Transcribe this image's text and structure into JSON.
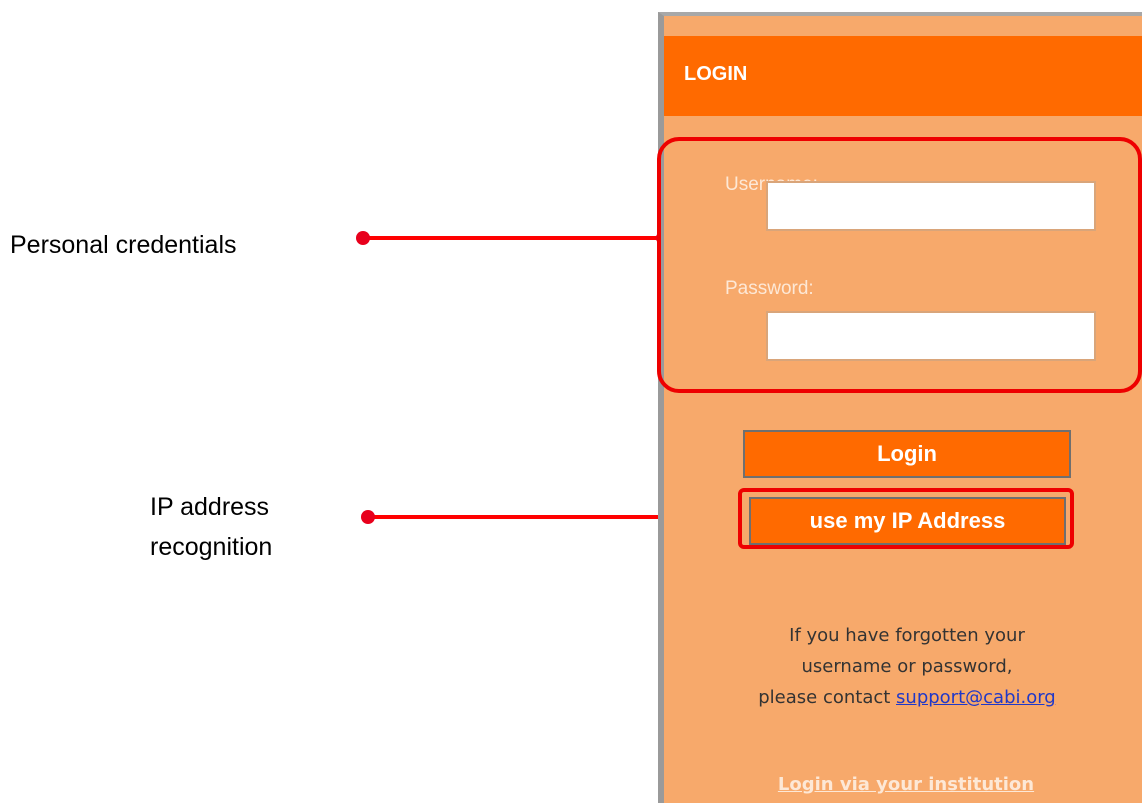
{
  "annotations": {
    "credentials_label": "Personal credentials",
    "ip_label_line1": "IP address",
    "ip_label_line2": "recognition",
    "highlight_color": "#ee0000"
  },
  "login_panel": {
    "title": "LOGIN",
    "username_label": "Username:",
    "username_value": "",
    "password_label": "Password:",
    "password_value": "",
    "login_button": "Login",
    "ip_button": "use my IP Address",
    "help_line1": "If you have forgotten your",
    "help_line2": "username or password,",
    "help_line3_prefix": "please contact ",
    "support_email": "support@cabi.org",
    "institution_link": "Login via your institution",
    "colors": {
      "panel_background": "#f7a96b",
      "header_background": "#ff6a00",
      "button_background": "#ff6a00"
    }
  }
}
